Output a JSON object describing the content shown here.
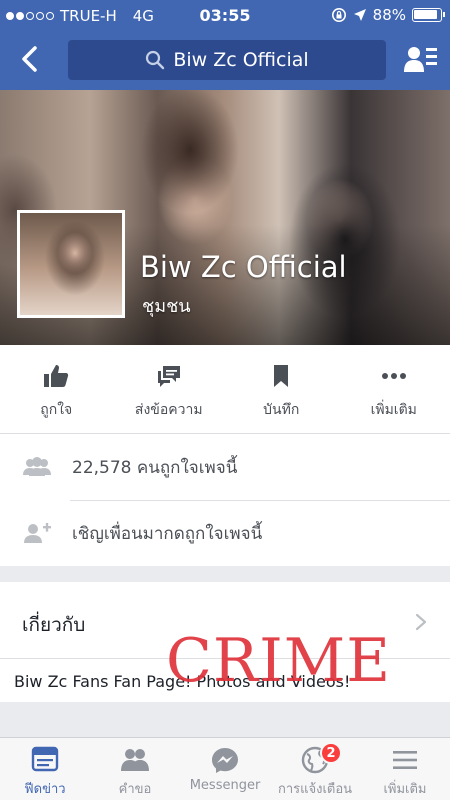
{
  "status_bar": {
    "carrier": "TRUE-H",
    "network": "4G",
    "time": "03:55",
    "battery": "88%"
  },
  "nav": {
    "search_text": "Biw Zc Official"
  },
  "page": {
    "name": "Biw Zc Official",
    "category": "ชุมชน"
  },
  "actions": [
    {
      "label": "ถูกใจ",
      "icon": "like-icon"
    },
    {
      "label": "ส่งข้อความ",
      "icon": "message-icon"
    },
    {
      "label": "บันทึก",
      "icon": "bookmark-icon"
    },
    {
      "label": "เพิ่มเติม",
      "icon": "more-icon"
    }
  ],
  "info": {
    "likes_text": "22,578 คนถูกใจเพจนี้",
    "invite_text": "เชิญเพื่อนมากดถูกใจเพจนี้"
  },
  "about": {
    "title": "เกี่ยวกับ",
    "description": "Biw Zc Fans Fan Page! Photos and Videos!"
  },
  "overlay": {
    "stamp_text": "CRIME"
  },
  "tabs": [
    {
      "label": "ฟีดข่าว",
      "active": true
    },
    {
      "label": "คำขอ",
      "active": false
    },
    {
      "label": "Messenger",
      "active": false
    },
    {
      "label": "การแจ้งเตือน",
      "active": false,
      "badge": "2"
    },
    {
      "label": "เพิ่มเติม",
      "active": false
    }
  ],
  "colors": {
    "brand": "#4267b2",
    "stamp": "#e0323a",
    "badge": "#fa3e3e"
  }
}
